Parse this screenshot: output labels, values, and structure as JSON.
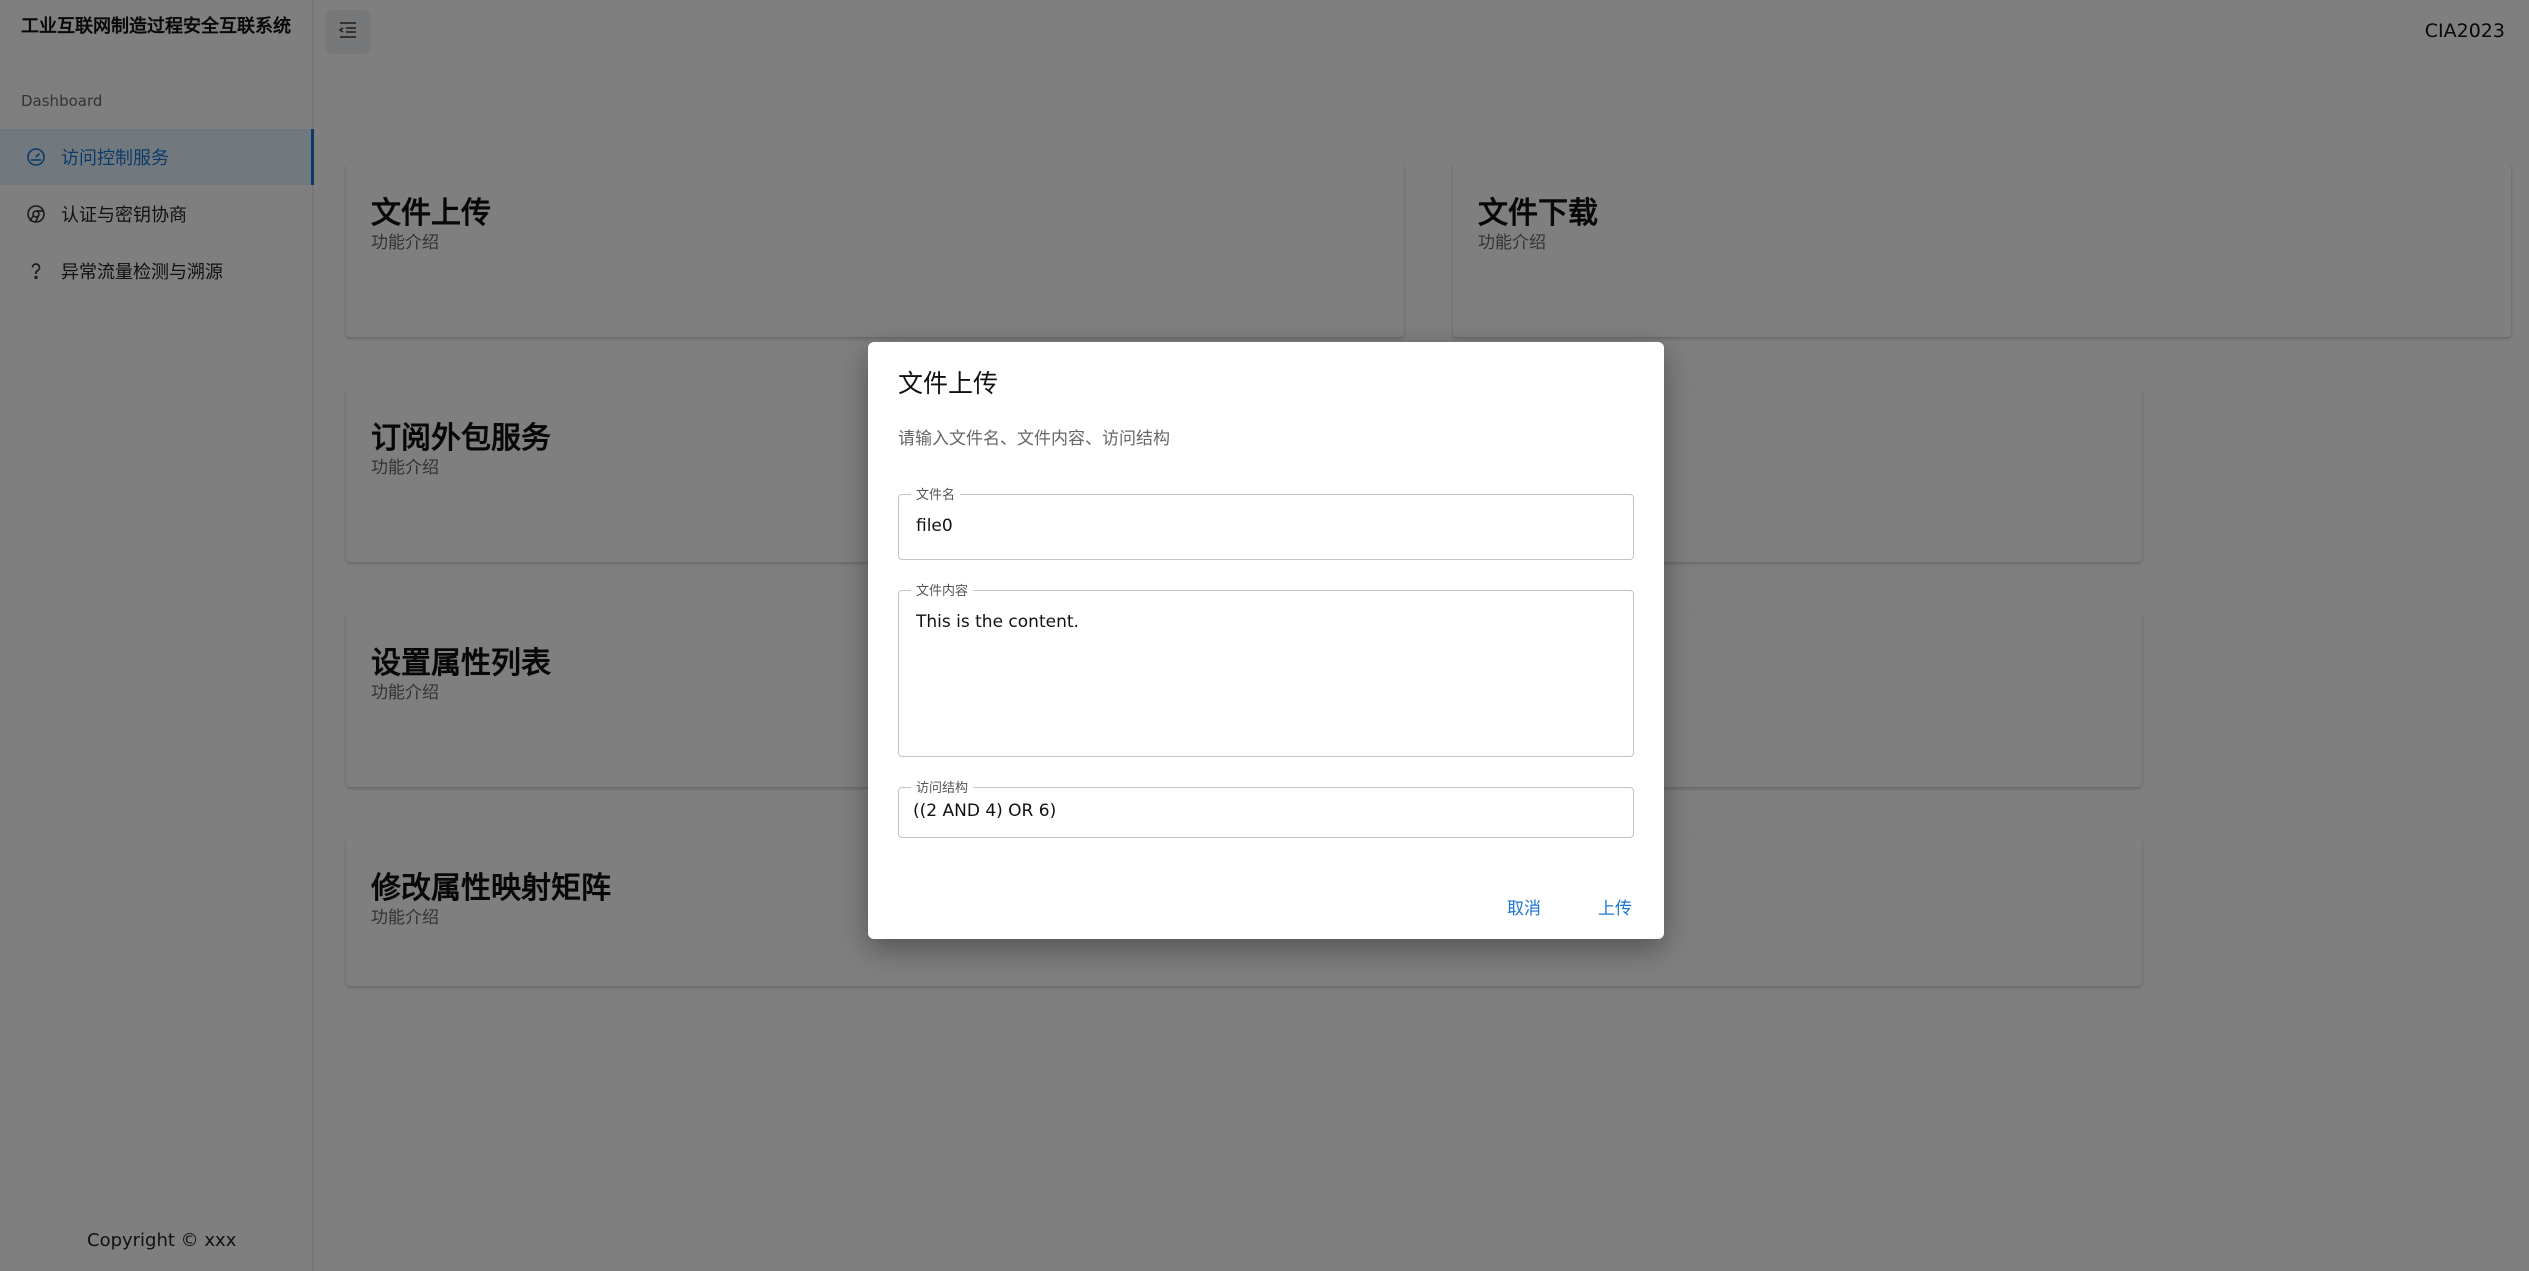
{
  "app": {
    "title": "工业互联网制造过程安全互联系统",
    "brand": "CIA2023",
    "section_label": "Dashboard",
    "copyright": "Copyright © xxx"
  },
  "sidebar": {
    "items": [
      {
        "label": "访问控制服务",
        "icon": "dashboard-gauge-icon",
        "active": true
      },
      {
        "label": "认证与密钥协商",
        "icon": "chrome-circle-icon",
        "active": false
      },
      {
        "label": "异常流量检测与溯源",
        "icon": "question-mark-icon",
        "active": false
      }
    ]
  },
  "cards": [
    {
      "title": "文件上传",
      "subtitle": "功能介绍"
    },
    {
      "title": "文件下载",
      "subtitle": "功能介绍"
    },
    {
      "title": "订阅外包服务",
      "subtitle": "功能介绍"
    },
    {
      "title": "设置属性列表",
      "subtitle": "功能介绍"
    },
    {
      "title": "修改属性映射矩阵",
      "subtitle": "功能介绍"
    }
  ],
  "dialog": {
    "title": "文件上传",
    "description": "请输入文件名、文件内容、访问结构",
    "fields": {
      "filename": {
        "label": "文件名",
        "value": "file0"
      },
      "content": {
        "label": "文件内容",
        "value": "This is the content."
      },
      "access": {
        "label": "访问结构",
        "value": "((2 AND 4) OR 6)"
      }
    },
    "cancel_label": "取消",
    "upload_label": "上传"
  },
  "colors": {
    "accent": "#1976d2",
    "active_bg": "#e3f0fc",
    "overlay": "rgba(0,0,0,0.5)"
  }
}
